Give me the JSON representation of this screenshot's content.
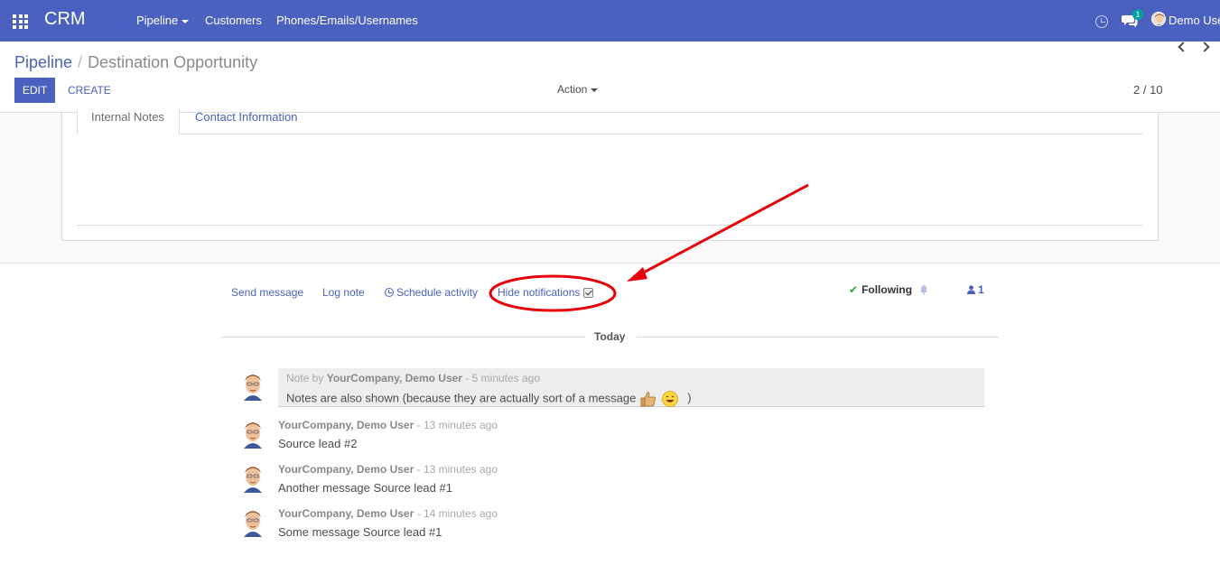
{
  "navbar": {
    "app_title": "CRM",
    "menu": [
      "Pipeline",
      "Customers",
      "Phones/Emails/Usernames"
    ],
    "chat_badge": "1",
    "user_name": "Demo User",
    "bg_color": "#4a61c0"
  },
  "control_panel": {
    "breadcrumb_parent": "Pipeline",
    "breadcrumb_separator": "/",
    "breadcrumb_current": "Destination Opportunity",
    "edit_label": "EDIT",
    "create_label": "CREATE",
    "action_label": "Action",
    "pager": "2 / 10"
  },
  "form": {
    "tabs": [
      "Internal Notes",
      "Contact Information"
    ]
  },
  "chatter": {
    "send_message": "Send message",
    "log_note": "Log note",
    "schedule_activity": "Schedule activity",
    "hide_notifications": "Hide notifications",
    "following": "Following",
    "followers_count": "1",
    "date_separator": "Today",
    "messages": [
      {
        "prefix": "Note by",
        "author": "YourCompany, Demo User",
        "time": "- 5 minutes ago",
        "body": "Notes are also shown (because they are actually sort of a message",
        "body_suffix": ")",
        "is_note": true,
        "emojis": [
          "thumbs-up-icon",
          "smile-icon"
        ]
      },
      {
        "author": "YourCompany, Demo User",
        "time": "- 13 minutes ago",
        "body": "Source lead #2"
      },
      {
        "author": "YourCompany, Demo User",
        "time": "- 13 minutes ago",
        "body": "Another message Source lead #1"
      },
      {
        "author": "YourCompany, Demo User",
        "time": "- 14 minutes ago",
        "body": "Some message Source lead #1"
      }
    ]
  },
  "annotation": {
    "color": "#e8000b"
  }
}
